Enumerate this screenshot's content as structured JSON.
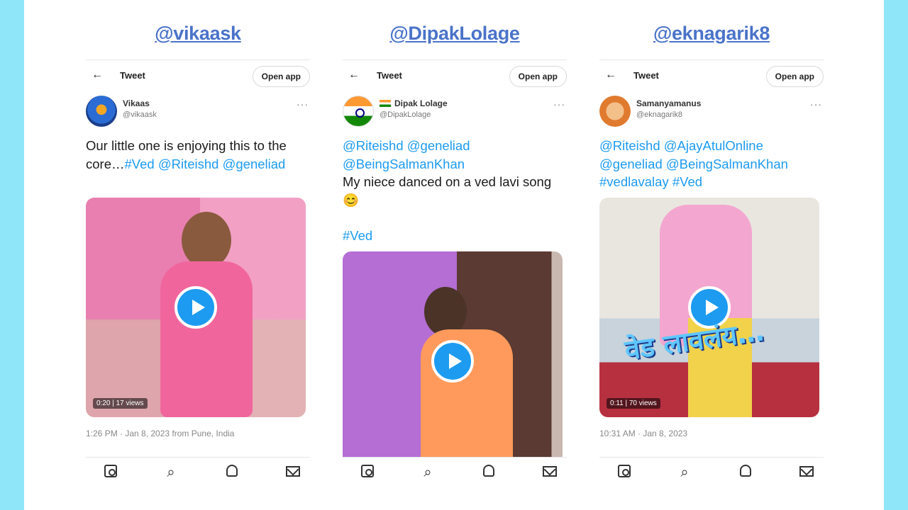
{
  "columns": [
    {
      "handle_title": "@vikaask",
      "tweet": {
        "back_icon": "arrow-left-icon",
        "title": "Tweet",
        "open_app_label": "Open app",
        "user_name": "Vikaas",
        "user_handle": "@vikaask",
        "more_icon": "···",
        "text_plain": "Our little one is enjoying this to the core…",
        "text_links": "#Ved @Riteishd @geneliad",
        "video_meta": "0:20 | 17 views",
        "timestamp": "1:26 PM · Jan 8, 2023 from Pune, India"
      }
    },
    {
      "handle_title": "@DipakLolage",
      "tweet": {
        "back_icon": "arrow-left-icon",
        "title": "Tweet",
        "open_app_label": "Open app",
        "user_name": "Dipak Lolage",
        "user_handle": "@DipakLolage",
        "more_icon": "···",
        "text_links_top": "@Riteishd @geneliad @BeingSalmanKhan",
        "text_plain": "My niece danced on a ved lavi song 😊",
        "text_links_bottom": "#Ved"
      }
    },
    {
      "handle_title": "@eknagarik8",
      "tweet": {
        "back_icon": "arrow-left-icon",
        "title": "Tweet",
        "open_app_label": "Open app",
        "user_name": "Samanyamanus",
        "user_handle": "@eknagarik8",
        "more_icon": "···",
        "text_links": "@Riteishd @AjayAtulOnline @geneliad @BeingSalmanKhan #vedlavalay #Ved",
        "video_overlay_text": "वेड लावलंय…",
        "video_meta": "0:11 | 70 views",
        "timestamp": "10:31 AM · Jan 8, 2023"
      }
    }
  ],
  "bottom_nav": {
    "icons": [
      "home-icon",
      "search-icon",
      "notifications-icon",
      "messages-icon"
    ]
  },
  "colors": {
    "frame": "#8ee6f8",
    "handle_link": "#4a73c9",
    "twitter_blue": "#1d9bf0"
  }
}
